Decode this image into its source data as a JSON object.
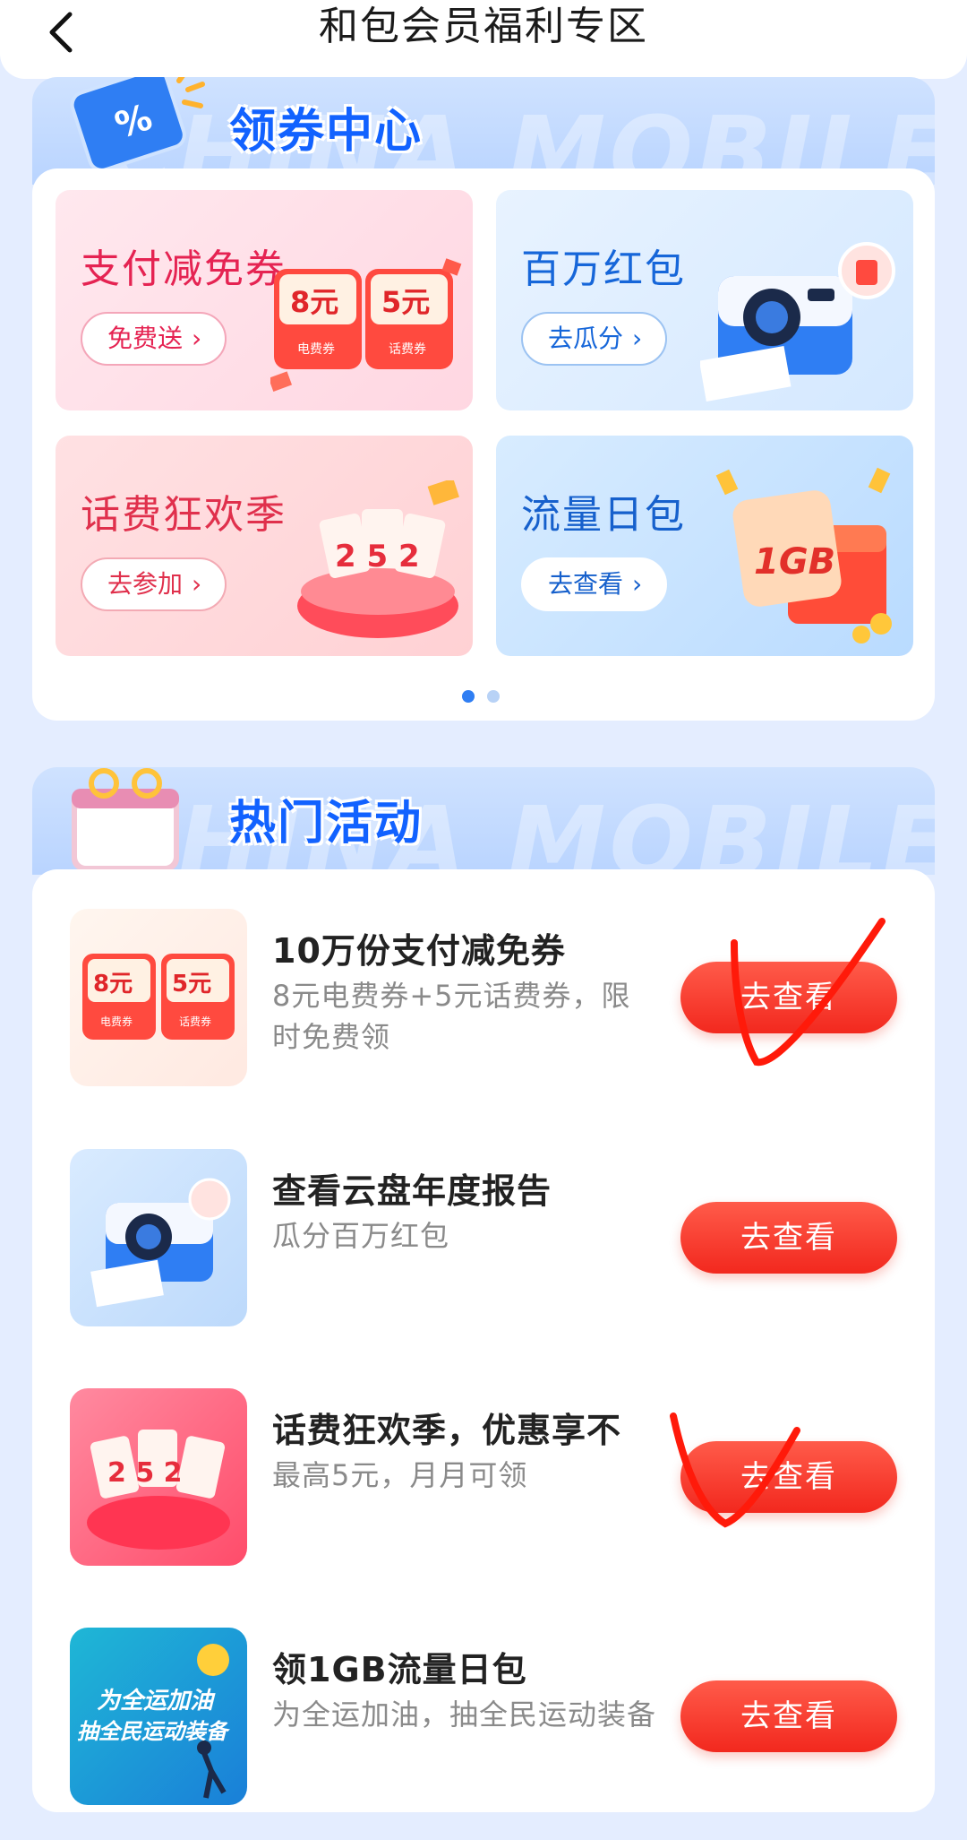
{
  "nav": {
    "title": "和包会员福利专区"
  },
  "coupon_center": {
    "title": "领券中心",
    "bg_text": "CHINA MOBILE",
    "tiles": [
      {
        "title": "支付减免券",
        "button": "免费送",
        "art": {
          "coupon1_amount": "8元",
          "coupon1_label": "电费券",
          "coupon2_amount": "5元",
          "coupon2_label": "话费券"
        }
      },
      {
        "title": "百万红包",
        "button": "去瓜分"
      },
      {
        "title": "话费狂欢季",
        "button": "去参加",
        "art": {
          "nums": "2 5 2"
        }
      },
      {
        "title": "流量日包",
        "button": "去查看",
        "art": {
          "gb": "1GB"
        }
      }
    ]
  },
  "hot_activities": {
    "title": "热门活动",
    "bg_text": "CHINA MOBILE",
    "items": [
      {
        "title": "10万份支付减免券",
        "desc": "8元电费券+5元话费券，限时免费领",
        "button": "去查看",
        "thumb": {
          "c1": "8元",
          "c1l": "电费券",
          "c2": "5元",
          "c2l": "话费券"
        }
      },
      {
        "title": "查看云盘年度报告",
        "desc": "瓜分百万红包",
        "button": "去查看"
      },
      {
        "title": "话费狂欢季，优惠享不",
        "desc": "最高5元，月月可领",
        "button": "去查看"
      },
      {
        "title": "领1GB流量日包",
        "desc": "为全运加油，抽全民运动装备",
        "button": "去查看",
        "thumb": {
          "line1": "为全运加油",
          "line2": "抽全民运动装备"
        }
      }
    ]
  },
  "colors": {
    "accent_blue": "#1262ff",
    "button_red": "#f2281e",
    "page_bg": "#e4edff"
  }
}
